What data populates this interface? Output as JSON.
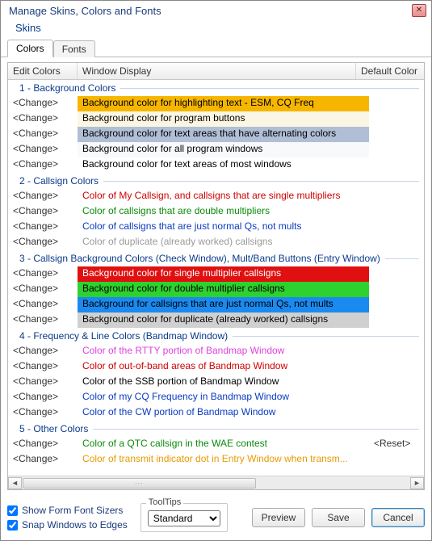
{
  "window": {
    "title": "Manage Skins, Colors and Fonts",
    "subtitle": "Skins"
  },
  "tabs": [
    {
      "label": "Colors",
      "active": true
    },
    {
      "label": "Fonts",
      "active": false
    }
  ],
  "columns": {
    "edit": "Edit Colors",
    "display": "Window Display",
    "default": "Default Color"
  },
  "edit_label": "<Change>",
  "reset_label": "<Reset>",
  "sections": [
    {
      "title": "1 - Background Colors",
      "rows": [
        {
          "text": "Background color for highlighting text - ESM, CQ Freq",
          "bg": "#f6b600",
          "fg": "#000000"
        },
        {
          "text": "Background color for program buttons",
          "bg": "#fbf6e4",
          "fg": "#000000"
        },
        {
          "text": "Background color for text areas that have alternating colors",
          "bg": "#b0bfd6",
          "fg": "#000000"
        },
        {
          "text": "Background color for all program windows",
          "bg": "#f7f9fb",
          "fg": "#000000"
        },
        {
          "text": "Background color for text areas of most windows",
          "bg": "#ffffff",
          "fg": "#000000"
        }
      ]
    },
    {
      "title": "2 - Callsign Colors",
      "rows": [
        {
          "text": "Color of My Callsign, and callsigns that are single multipliers",
          "bg": "#ffffff",
          "fg": "#d00000"
        },
        {
          "text": "Color of callsigns that are double multipliers",
          "bg": "#ffffff",
          "fg": "#0a8a0a"
        },
        {
          "text": "Color of callsigns that are just normal Qs, not mults",
          "bg": "#ffffff",
          "fg": "#0a3ac0"
        },
        {
          "text": "Color of duplicate (already worked) callsigns",
          "bg": "#ffffff",
          "fg": "#9a9a9a"
        }
      ]
    },
    {
      "title": "3 - Callsign Background Colors (Check Window), Mult/Band Buttons (Entry Window)",
      "rows": [
        {
          "text": "Background color for single multiplier callsigns",
          "bg": "#e01010",
          "fg": "#ffffff"
        },
        {
          "text": "Background color for double multiplier callsigns",
          "bg": "#2ed22e",
          "fg": "#000000"
        },
        {
          "text": "Background for callsigns that are just normal Qs, not mults",
          "bg": "#1a8af0",
          "fg": "#000000"
        },
        {
          "text": "Background color for duplicate (already worked) callsigns",
          "bg": "#d0d0d0",
          "fg": "#000000"
        }
      ]
    },
    {
      "title": "4 - Frequency & Line Colors (Bandmap Window)",
      "rows": [
        {
          "text": "Color of the RTTY portion of Bandmap Window",
          "bg": "#ffffff",
          "fg": "#e040e0"
        },
        {
          "text": "Color of out-of-band areas of Bandmap Window",
          "bg": "#ffffff",
          "fg": "#d00000"
        },
        {
          "text": "Color of the SSB portion of Bandmap Window",
          "bg": "#ffffff",
          "fg": "#000000"
        },
        {
          "text": "Color of my CQ Frequency in Bandmap Window",
          "bg": "#ffffff",
          "fg": "#0a3ac0"
        },
        {
          "text": "Color of the CW portion of Bandmap Window",
          "bg": "#ffffff",
          "fg": "#0a3ac0"
        }
      ]
    },
    {
      "title": "5 - Other Colors",
      "rows": [
        {
          "text": "Color of a QTC callsign in the WAE contest",
          "bg": "#ffffff",
          "fg": "#0a8a0a",
          "reset": true
        },
        {
          "text": "Color of transmit indicator dot in Entry Window when transm...",
          "bg": "#ffffff",
          "fg": "#e89a00"
        }
      ]
    }
  ],
  "footer": {
    "show_sizers": "Show Form Font Sizers",
    "snap_edges": "Snap Windows to Edges",
    "tooltips_legend": "ToolTips",
    "tooltips_value": "Standard",
    "preview": "Preview",
    "save": "Save",
    "cancel": "Cancel"
  }
}
